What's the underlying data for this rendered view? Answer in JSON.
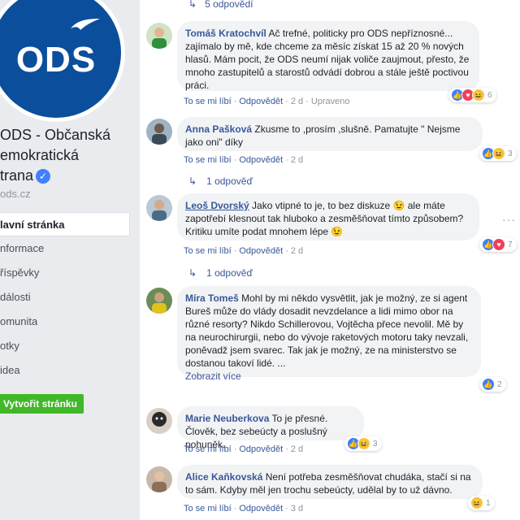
{
  "page": {
    "logo_text": "ODS",
    "name": "ODS - Občanská demokratická strana",
    "name_lines": [
      "ODS - Občanská",
      "emokratická",
      "trana"
    ],
    "email": "ods.cz",
    "nav": [
      "lavní stránka",
      "nformace",
      "říspěvky",
      "dálosti",
      "omunita",
      "otky",
      "idea"
    ],
    "create_button": "Vytvořit stránku"
  },
  "top_replies": "5 odpovědí",
  "actions": {
    "like": "To se mi líbí",
    "reply": "Odpovědět",
    "edited": "Upraveno"
  },
  "comments": [
    {
      "author": "Tomáš Kratochvíl",
      "text": "Ač trefné, politicky pro ODS nepříznosné... zajímalo by mě, kde chceme za měsíc získat 15 až 20 % nových hlasů. Mám pocit, že ODS neumí nijak voliče zaujmout, přesto, že mnoho zastupitelů a starostů odvádí dobrou a stále ještě poctivou práci.",
      "time": "2 d",
      "edited": true,
      "reactions": [
        "like",
        "love",
        "haha"
      ],
      "count": "6"
    },
    {
      "author": "Anna Pašková",
      "text": "Zkusme to ,prosím ,slušně. Pamatujte \" Nejsme jako oni\" díky",
      "time": "2 d",
      "reactions": [
        "like",
        "haha"
      ],
      "count": "3",
      "replies": "1 odpověď"
    },
    {
      "author": "Leoš Dvorský",
      "text": "Jako vtipné to je, to bez diskuze 😉 ale máte zapotřebí klesnout tak hluboko a zesměšňovat tímto způsobem? Kritiku umíte podat mnohem lépe 😉",
      "time": "2 d",
      "reactions": [
        "like",
        "love"
      ],
      "count": "7",
      "replies": "1 odpověď"
    },
    {
      "author": "Míra Tomeš",
      "text": "Mohl by mi někdo vysvětlit, jak je možný, ze si agent Bureš může do vlády dosadit nevzdelance a lidi mimo obor na různé resorty? Nikdo Schillerovou, Vojtěcha přece nevolil. Mě by na neurochirurgii, nebo do vývoje raketových motoru taky nevzali, poněvadž jsem svarec. Tak jak je možný, ze na ministerstvo se dostanou takoví lidé. ...",
      "more": "Zobrazit více",
      "time": "2 d",
      "reactions": [
        "like"
      ],
      "count": "2"
    },
    {
      "author": "Marie Neuberkova",
      "text": "To je přesné. Člověk, bez sebeúcty a poslušný pohuněk.",
      "time": "2 d",
      "reactions": [
        "like",
        "haha"
      ],
      "count": "3"
    },
    {
      "author": "Alice Kaňkovská",
      "text": "Není potřeba zesměšňovat chudáka, stačí si na to sám. Kdyby měl jen trochu sebeúcty, udělal by to už dávno.",
      "time": "3 d",
      "reactions": [
        "haha"
      ],
      "count": "1"
    }
  ],
  "colors": {
    "link": "#385898",
    "ods_blue": "#0b4f9c",
    "bubble": "#f2f3f5",
    "create_green": "#42b72a"
  }
}
